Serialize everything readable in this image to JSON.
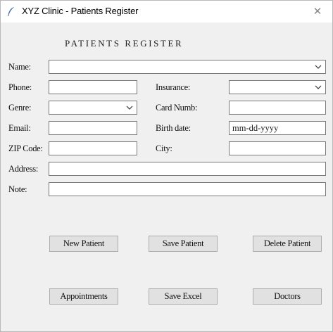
{
  "window": {
    "title": "XYZ Clinic - Patients Register",
    "app_icon": "feather-icon",
    "close_glyph": "✕"
  },
  "form": {
    "heading": "PATIENTS REGISTER",
    "labels": {
      "name": "Name:",
      "phone": "Phone:",
      "insurance": "Insurance:",
      "genre": "Genre:",
      "card_number": "Card Numb:",
      "email": "Email:",
      "birth_date": "Birth date:",
      "zip_code": "ZIP Code:",
      "city": "City:",
      "address": "Address:",
      "note": "Note:"
    },
    "values": {
      "name": "",
      "phone": "",
      "insurance": "",
      "genre": "",
      "card_number": "",
      "email": "",
      "birth_date": "mm-dd-yyyy",
      "zip_code": "",
      "city": "",
      "address": "",
      "note": ""
    }
  },
  "buttons": {
    "new_patient": "New Patient",
    "save_patient": "Save Patient",
    "delete_patient": "Delete Patient",
    "appointments": "Appointments",
    "save_excel": "Save Excel",
    "doctors": "Doctors"
  }
}
